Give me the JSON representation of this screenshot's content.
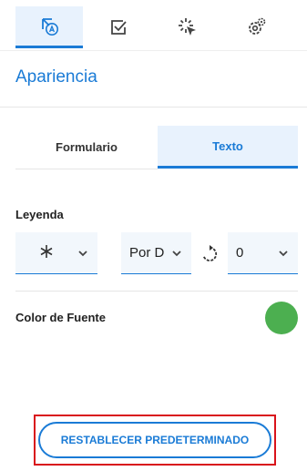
{
  "top_tabs": [
    {
      "icon": "appearance-icon",
      "active": true
    },
    {
      "icon": "checkbox-icon",
      "active": false
    },
    {
      "icon": "click-icon",
      "active": false
    },
    {
      "icon": "settings-icon",
      "active": false
    }
  ],
  "section": {
    "title": "Apariencia"
  },
  "sub_tabs": [
    {
      "label": "Formulario",
      "active": false
    },
    {
      "label": "Texto",
      "active": true
    }
  ],
  "legend": {
    "label": "Leyenda",
    "icon_select": {
      "icon": "asterisk-icon"
    },
    "position_select": {
      "value": "Por D"
    },
    "rotation_icon": "rotate-icon",
    "rotation_select": {
      "value": "0"
    }
  },
  "font_color": {
    "label": "Color de Fuente",
    "value": "#4caf50"
  },
  "reset_button": {
    "label": "RESTABLECER PREDETERMINADO"
  },
  "colors": {
    "accent": "#1a7bd6",
    "active_bg": "#e8f2fd",
    "highlight": "#d9131b"
  }
}
